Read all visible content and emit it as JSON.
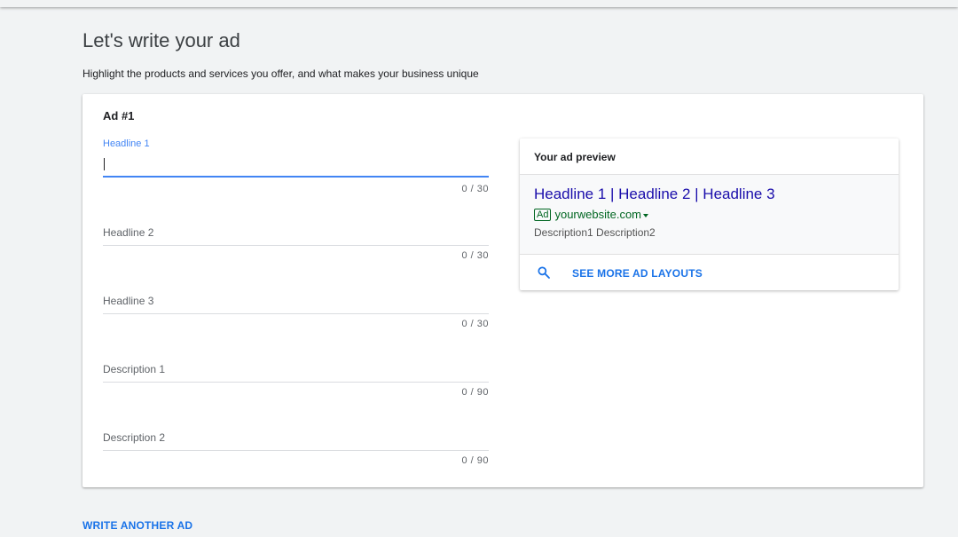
{
  "page": {
    "title": "Let's write your ad",
    "subtitle": "Highlight the products and services you offer, and what makes your business unique",
    "write_another_label": "WRITE ANOTHER AD"
  },
  "ad": {
    "title": "Ad #1",
    "fields": [
      {
        "label": "Headline 1",
        "value": "",
        "counter": "0 / 30",
        "active": true
      },
      {
        "label": "Headline 2",
        "value": "",
        "counter": "0 / 30",
        "active": false
      },
      {
        "label": "Headline 3",
        "value": "",
        "counter": "0 / 30",
        "active": false
      },
      {
        "label": "Description 1",
        "value": "",
        "counter": "0 / 90",
        "active": false
      },
      {
        "label": "Description 2",
        "value": "",
        "counter": "0 / 90",
        "active": false
      }
    ]
  },
  "preview": {
    "title": "Your ad preview",
    "headline": "Headline 1 | Headline 2 | Headline 3",
    "ad_badge": "Ad",
    "url": "yourwebsite.com",
    "description": "Description1 Description2",
    "see_more_label": "SEE MORE AD LAYOUTS",
    "icons": [
      "search-icon",
      "caret-down-icon"
    ]
  },
  "colors": {
    "accent": "#4285f4",
    "link_blue": "#1a73e8",
    "headline_blue": "#1a0dab",
    "url_green": "#006621",
    "background": "#f1f3f4"
  }
}
